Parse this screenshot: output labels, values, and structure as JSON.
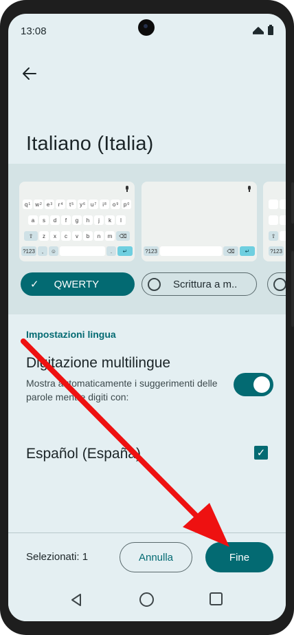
{
  "status_bar": {
    "time": "13:08",
    "icons": [
      "wifi-icon",
      "battery-icon"
    ]
  },
  "header": {
    "back_icon": "arrow-left-icon",
    "title": "Italiano (Italia)"
  },
  "layouts": {
    "keyboard_rows": {
      "row1": [
        "q",
        "w",
        "e",
        "r",
        "t",
        "y",
        "u",
        "i",
        "o",
        "p"
      ],
      "row1_hints": [
        "1",
        "2",
        "3",
        "4",
        "5",
        "6",
        "7",
        "8",
        "9",
        "0"
      ],
      "row2": [
        "a",
        "s",
        "d",
        "f",
        "g",
        "h",
        "j",
        "k",
        "l"
      ],
      "row3": [
        "z",
        "x",
        "c",
        "v",
        "b",
        "n",
        "m"
      ],
      "bottom": {
        "symbols": "?123",
        "comma": ",",
        "period": "."
      }
    },
    "options": [
      {
        "label": "QWERTY",
        "selected": true
      },
      {
        "label": "Scrittura a m..",
        "selected": false
      },
      {
        "label": "",
        "selected": false
      }
    ]
  },
  "settings": {
    "section_header": "Impostazioni lingua",
    "multilingual": {
      "title": "Digitazione multilingue",
      "description": "Mostra automaticamente i suggerimenti delle parole mentre digiti con:",
      "enabled": true
    },
    "languages": [
      {
        "label": "Español (España)",
        "checked": true
      }
    ]
  },
  "footer": {
    "selected_count": "Selezionati: 1",
    "cancel_label": "Annulla",
    "done_label": "Fine"
  },
  "nav_bar": {
    "icons": [
      "nav-back-icon",
      "nav-home-icon",
      "nav-recents-icon"
    ]
  },
  "colors": {
    "accent": "#036a72",
    "accent_light": "#6fcfe0",
    "background": "#e4eff2",
    "annotation_arrow": "#ee1111"
  }
}
